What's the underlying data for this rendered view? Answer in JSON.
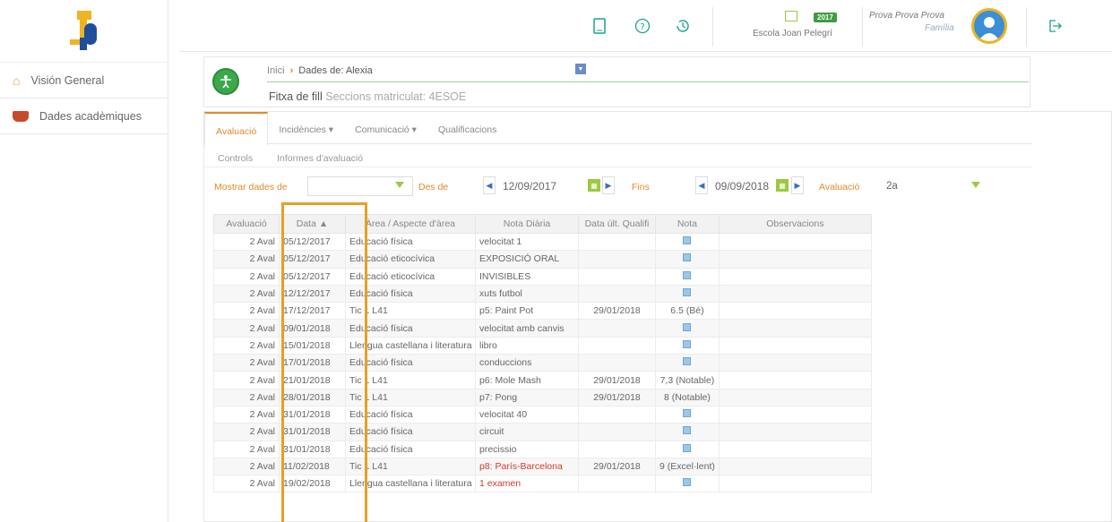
{
  "sidebar": {
    "items": [
      {
        "label": "Visión General",
        "icon": "home-icon"
      },
      {
        "label": "Dades acadèmiques",
        "icon": "graduation-cap-icon"
      }
    ]
  },
  "header": {
    "school_year": "2017",
    "school_name": "Escola Joan Pelegrí",
    "user_name": "Prova Prova Prova",
    "user_role": "Família"
  },
  "breadcrumb": {
    "home": "Inici",
    "current": "Dades de: Alexia",
    "title": "Fitxa de fill",
    "subtitle": "Seccions matriculat: 4ESOE"
  },
  "tabs": [
    {
      "label": "Avaluació",
      "active": true
    },
    {
      "label": "Incidències ▾",
      "active": false
    },
    {
      "label": "Comunicació ▾",
      "active": false
    },
    {
      "label": "Qualificacions",
      "active": false
    }
  ],
  "subtabs": [
    {
      "label": "Controls"
    },
    {
      "label": "Informes d'avaluació"
    }
  ],
  "filters": {
    "show_label": "Mostrar dades de",
    "show_value": "",
    "from_label": "Des de",
    "from_date": "12/09/2017",
    "to_label": "Fins",
    "to_date": "09/09/2018",
    "eval_label": "Avaluació",
    "eval_value": "2a"
  },
  "table": {
    "headers": [
      "Avaluació",
      "Data ▲",
      "Àrea / Aspecte d'àrea",
      "Nota Diària",
      "Data últ. Qualifi",
      "Nota",
      "Observacions"
    ],
    "rows": [
      {
        "aval": "2 Aval",
        "data": "05/12/2017",
        "area": "Educació física",
        "nota_diaria": "velocitat 1",
        "data_ult": "",
        "nota": "",
        "red": false
      },
      {
        "aval": "2 Aval",
        "data": "05/12/2017",
        "area": "Educació eticocívica",
        "nota_diaria": "EXPOSICIÓ ORAL",
        "data_ult": "",
        "nota": "",
        "red": false
      },
      {
        "aval": "2 Aval",
        "data": "05/12/2017",
        "area": "Educació eticocívica",
        "nota_diaria": "INVISIBLES",
        "data_ult": "",
        "nota": "",
        "red": false
      },
      {
        "aval": "2 Aval",
        "data": "12/12/2017",
        "area": "Educació física",
        "nota_diaria": "xuts futbol",
        "data_ult": "",
        "nota": "",
        "red": false
      },
      {
        "aval": "2 Aval",
        "data": "17/12/2017",
        "area": "Tic 1 L41",
        "nota_diaria": "p5: Paint Pot",
        "data_ult": "29/01/2018",
        "nota": "6.5 (Bé)",
        "red": false
      },
      {
        "aval": "2 Aval",
        "data": "09/01/2018",
        "area": "Educació física",
        "nota_diaria": "velocitat amb canvis",
        "data_ult": "",
        "nota": "",
        "red": false
      },
      {
        "aval": "2 Aval",
        "data": "15/01/2018",
        "area": "Llengua castellana i literatura",
        "nota_diaria": "libro",
        "data_ult": "",
        "nota": "",
        "red": false
      },
      {
        "aval": "2 Aval",
        "data": "17/01/2018",
        "area": "Educació física",
        "nota_diaria": "conduccions",
        "data_ult": "",
        "nota": "",
        "red": false
      },
      {
        "aval": "2 Aval",
        "data": "21/01/2018",
        "area": "Tic 1 L41",
        "nota_diaria": "p6: Mole Mash",
        "data_ult": "29/01/2018",
        "nota": "7,3 (Notable)",
        "red": false
      },
      {
        "aval": "2 Aval",
        "data": "28/01/2018",
        "area": "Tic 1 L41",
        "nota_diaria": "p7: Pong",
        "data_ult": "29/01/2018",
        "nota": "8 (Notable)",
        "red": false
      },
      {
        "aval": "2 Aval",
        "data": "31/01/2018",
        "area": "Educació física",
        "nota_diaria": "velocitat 40",
        "data_ult": "",
        "nota": "",
        "red": false
      },
      {
        "aval": "2 Aval",
        "data": "31/01/2018",
        "area": "Educació física",
        "nota_diaria": "circuit",
        "data_ult": "",
        "nota": "",
        "red": false
      },
      {
        "aval": "2 Aval",
        "data": "31/01/2018",
        "area": "Educació física",
        "nota_diaria": "precissio",
        "data_ult": "",
        "nota": "",
        "red": false
      },
      {
        "aval": "2 Aval",
        "data": "11/02/2018",
        "area": "Tic 1 L41",
        "nota_diaria": "p8: París-Barcelona",
        "data_ult": "29/01/2018",
        "nota": "9 (Excel·lent)",
        "red": true
      },
      {
        "aval": "2 Aval",
        "data": "19/02/2018",
        "area": "Llengua castellana i literatura",
        "nota_diaria": "1 examen",
        "data_ult": "",
        "nota": "",
        "red": true
      }
    ]
  },
  "colors": {
    "accent": "#e28a2b",
    "green": "#3aa84b",
    "teal": "#1aa38c",
    "highlight_border": "#e4a026"
  }
}
